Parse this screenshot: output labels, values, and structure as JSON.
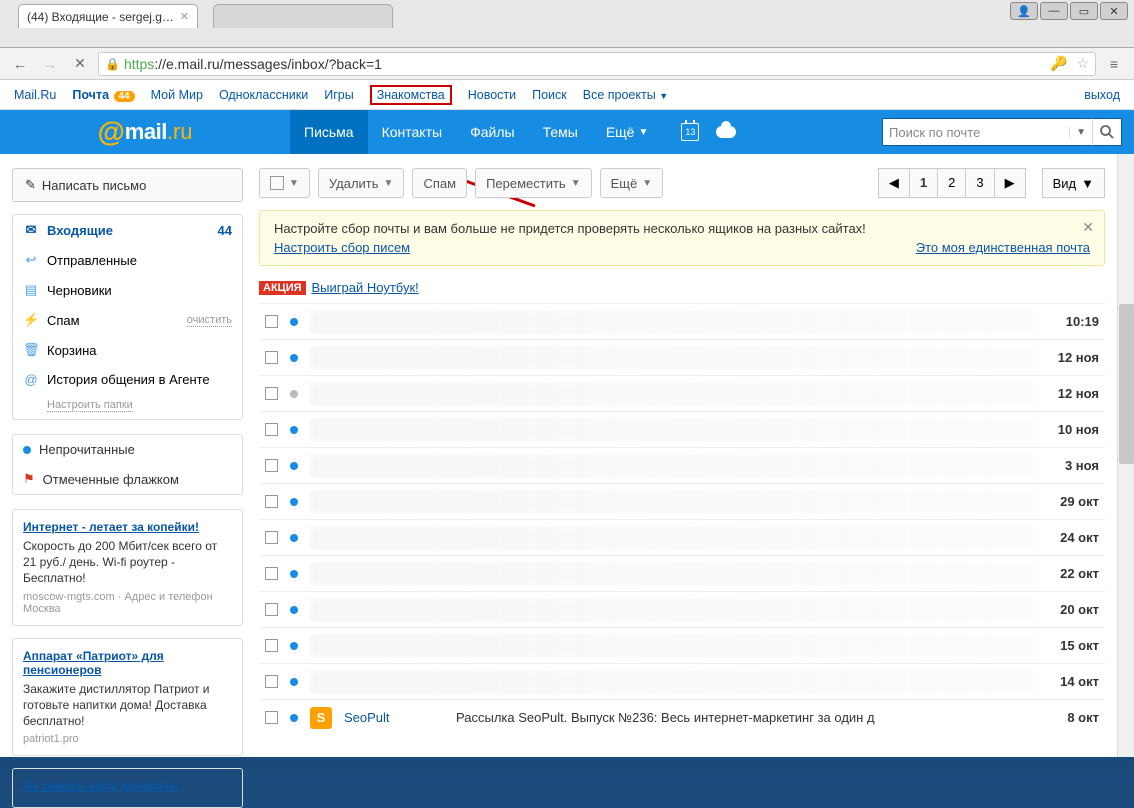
{
  "browser": {
    "tab_title": "(44) Входящие - sergej.g…",
    "url_scheme": "https",
    "url_rest": "://e.mail.ru/messages/inbox/?back=1"
  },
  "topnav": {
    "items": [
      "Mail.Ru",
      "Почта",
      "Мой Мир",
      "Одноклассники",
      "Игры",
      "Знакомства",
      "Новости",
      "Поиск",
      "Все проекты"
    ],
    "badge": "44",
    "logout": "выход"
  },
  "mainnav": {
    "logo_mail": "mail",
    "logo_ru": ".ru",
    "tabs": [
      "Письма",
      "Контакты",
      "Файлы",
      "Темы",
      "Ещё"
    ],
    "cal_day": "13",
    "search_placeholder": "Поиск по почте"
  },
  "compose_label": "Написать письмо",
  "folders": [
    {
      "icon": "✉",
      "label": "Входящие",
      "count": "44",
      "cls": "inbox",
      "color": "#0857a6"
    },
    {
      "icon": "↩",
      "label": "Отправленные",
      "cls": "",
      "color": "#4aa0e8"
    },
    {
      "icon": "▤",
      "label": "Черновики",
      "cls": "",
      "color": "#4aa0e8"
    },
    {
      "icon": "⚡",
      "label": "Спам",
      "cls": "spam",
      "color": "#4aa0e8",
      "clear": "очистить"
    },
    {
      "icon": "🗑",
      "label": "Корзина",
      "cls": "",
      "color": "#4aa0e8"
    },
    {
      "icon": "@",
      "label": "История общения в Агенте",
      "cls": "",
      "color": "#4aa0e8"
    }
  ],
  "folder_config": "Настроить папки",
  "filters": [
    {
      "type": "dot",
      "color": "blue",
      "label": "Непрочитанные"
    },
    {
      "type": "flag",
      "label": "Отмеченные флажком"
    }
  ],
  "ads": [
    {
      "title": "Интернет - летает за копейки!",
      "text": "Скорость до 200 Мбит/сек всего от 21 руб./ день. Wi-fi роутер - Бесплатно!",
      "src": "moscow-mgts.com · Адрес и телефон Москва"
    },
    {
      "title": "Аппарат «Патриот» для пенсионеров",
      "text": "Закажите дистиллятор Патриот и готовьте напитки дома! Доставка бесплатно!",
      "src": "patriot1.pro"
    },
    {
      "title": "Не знаешь кому доверить",
      "text": "",
      "src": ""
    }
  ],
  "toolbar": {
    "delete": "Удалить",
    "spam": "Спам",
    "move": "Переместить",
    "more": "Ещё",
    "pages": [
      "1",
      "2",
      "3"
    ],
    "view": "Вид"
  },
  "notice": {
    "text": "Настройте сбор почты и вам больше не придется проверять несколько ящиков на разных сайтах!",
    "link1": "Настроить сбор писем",
    "link2": "Это моя единственная почта"
  },
  "promo": {
    "badge": "АКЦИЯ",
    "link": "Выиграй Ноутбук!"
  },
  "messages": [
    {
      "dot": "blue",
      "time": "10:19"
    },
    {
      "dot": "blue",
      "time": "12 ноя"
    },
    {
      "dot": "gray",
      "time": "12 ноя"
    },
    {
      "dot": "blue",
      "time": "10 ноя"
    },
    {
      "dot": "blue",
      "time": "3 ноя"
    },
    {
      "dot": "blue",
      "time": "29 окт"
    },
    {
      "dot": "blue",
      "time": "24 окт"
    },
    {
      "dot": "blue",
      "time": "22 окт"
    },
    {
      "dot": "blue",
      "time": "20 окт"
    },
    {
      "dot": "blue",
      "time": "15 окт"
    },
    {
      "dot": "blue",
      "time": "14 окт"
    }
  ],
  "last_msg": {
    "avatar": "S",
    "sender": "SeoPult",
    "subject": "Рассылка SeoPult. Выпуск №236: Весь интернет-маркетинг за один д",
    "time": "8 окт"
  }
}
